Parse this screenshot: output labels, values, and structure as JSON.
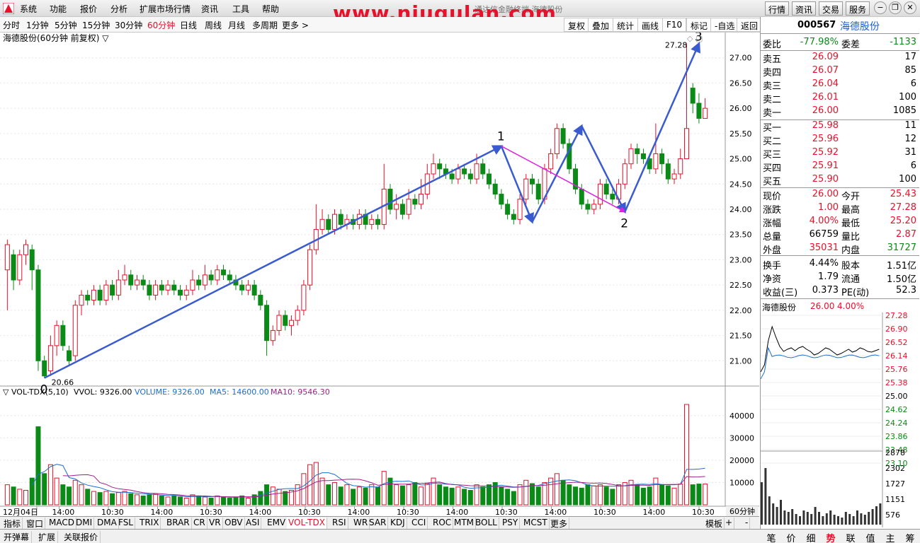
{
  "menu": {
    "items": [
      "系统",
      "功能",
      "报价",
      "分析",
      "扩展市场行情",
      "资讯",
      "工具",
      "帮助"
    ],
    "center_title": "通达信金融终端  海德股份",
    "watermark": "www.niugulan.com",
    "right_buttons": [
      "行情",
      "资讯",
      "交易",
      "服务"
    ]
  },
  "periods": {
    "items": [
      "分时",
      "1分钟",
      "5分钟",
      "15分钟",
      "30分钟",
      "60分钟",
      "日线",
      "周线",
      "月线",
      "多周期",
      "更多 >"
    ],
    "active": "60分钟",
    "tools": [
      "复权",
      "叠加",
      "统计",
      "画线",
      "F10",
      "标记",
      "-自选",
      "返回"
    ]
  },
  "chart": {
    "title": "海德股份(60分钟 前复权) ▽",
    "price_axis": [
      "27.00",
      "26.50",
      "26.00",
      "25.50",
      "25.00",
      "24.50",
      "24.00",
      "23.50",
      "23.00",
      "22.50",
      "22.00",
      "21.50",
      "21.00"
    ],
    "high_label": "27.28",
    "low_label": "20.66",
    "wave_labels": [
      "0",
      "1",
      "2",
      "3"
    ],
    "vol_header": {
      "name": "▽ VOL-TDX(5,10)",
      "vvol": "VVOL: 9326.00",
      "volume": "VOLUME: 9326.00",
      "ma5": "MA5: 14600.00",
      "ma10": "MA10: 9546.30"
    },
    "vol_axis": [
      "40000",
      "30000",
      "20000",
      "10000"
    ],
    "time_axis": [
      "12月04日",
      "14:00",
      "10:30",
      "14:00",
      "10:30",
      "14:00",
      "10:30",
      "14:00",
      "10:30",
      "14:00",
      "10:30",
      "14:00",
      "10:30",
      "14:00",
      "10:30"
    ],
    "period_badge": "60分钟",
    "colors": {
      "up": "#e8102a",
      "down": "#0a8a16",
      "wave": "#3a5bd0",
      "wave2": "#e020e0",
      "ma5": "#1a6fd0",
      "ma10": "#a0208a"
    }
  },
  "chart_data": {
    "type": "candlestick",
    "title": "海德股份(60分钟 前复权)",
    "ylim": [
      20.5,
      27.5
    ],
    "candles": [
      [
        22.8,
        23.3,
        23.4,
        22.0
      ],
      [
        23.1,
        22.6,
        23.2,
        22.4
      ],
      [
        22.6,
        23.1,
        23.2,
        22.5
      ],
      [
        23.1,
        23.3,
        23.4,
        22.9
      ],
      [
        23.2,
        22.8,
        23.3,
        22.4
      ],
      [
        22.8,
        21.0,
        22.9,
        20.8
      ],
      [
        21.0,
        20.7,
        21.1,
        20.66
      ],
      [
        20.8,
        21.3,
        21.5,
        20.7
      ],
      [
        21.3,
        21.7,
        21.8,
        21.1
      ],
      [
        21.7,
        21.3,
        21.8,
        21.2
      ],
      [
        21.2,
        21.0,
        21.3,
        20.9
      ],
      [
        21.1,
        22.1,
        22.2,
        21.0
      ],
      [
        22.1,
        22.3,
        22.4,
        21.9
      ],
      [
        22.3,
        22.2,
        22.4,
        22.1
      ],
      [
        22.2,
        22.4,
        22.5,
        22.1
      ],
      [
        22.4,
        22.2,
        22.5,
        22.1
      ],
      [
        22.2,
        22.5,
        22.6,
        22.1
      ],
      [
        22.5,
        22.3,
        22.6,
        22.2
      ],
      [
        22.3,
        22.6,
        22.8,
        22.2
      ],
      [
        22.6,
        22.7,
        22.9,
        22.5
      ],
      [
        22.7,
        22.5,
        22.8,
        22.4
      ],
      [
        22.5,
        22.6,
        22.7,
        22.4
      ],
      [
        22.6,
        22.5,
        22.7,
        22.4
      ],
      [
        22.5,
        22.3,
        22.6,
        22.2
      ],
      [
        22.3,
        22.5,
        22.6,
        22.2
      ],
      [
        22.5,
        22.4,
        22.6,
        22.3
      ],
      [
        22.4,
        22.5,
        22.6,
        22.3
      ],
      [
        22.5,
        22.4,
        22.6,
        22.3
      ],
      [
        22.4,
        22.3,
        22.5,
        22.2
      ],
      [
        22.3,
        22.4,
        22.5,
        22.2
      ],
      [
        22.4,
        22.6,
        22.8,
        22.3
      ],
      [
        22.6,
        22.5,
        22.7,
        22.4
      ],
      [
        22.5,
        22.7,
        22.9,
        22.4
      ],
      [
        22.7,
        22.6,
        22.8,
        22.5
      ],
      [
        22.6,
        22.8,
        22.9,
        22.5
      ],
      [
        22.8,
        22.7,
        22.9,
        22.6
      ],
      [
        22.7,
        22.6,
        22.8,
        22.5
      ],
      [
        22.6,
        22.5,
        22.7,
        22.4
      ],
      [
        22.5,
        22.4,
        22.6,
        22.3
      ],
      [
        22.4,
        22.5,
        22.6,
        22.3
      ],
      [
        22.5,
        22.3,
        22.6,
        22.2
      ],
      [
        22.3,
        22.1,
        22.4,
        22.0
      ],
      [
        22.1,
        21.4,
        22.2,
        21.1
      ],
      [
        21.4,
        21.6,
        21.7,
        21.3
      ],
      [
        21.6,
        21.9,
        22.0,
        21.5
      ],
      [
        21.9,
        21.7,
        22.0,
        21.6
      ],
      [
        21.7,
        21.8,
        21.9,
        21.5
      ],
      [
        21.8,
        22.0,
        22.1,
        21.7
      ],
      [
        22.0,
        22.5,
        22.6,
        21.9
      ],
      [
        22.5,
        23.2,
        23.3,
        22.4
      ],
      [
        23.2,
        23.6,
        24.1,
        23.1
      ],
      [
        23.6,
        23.8,
        24.0,
        23.5
      ],
      [
        23.8,
        23.6,
        23.9,
        23.5
      ],
      [
        23.6,
        23.9,
        24.0,
        23.5
      ],
      [
        23.9,
        23.7,
        24.0,
        23.6
      ],
      [
        23.7,
        23.8,
        23.9,
        23.6
      ],
      [
        23.8,
        23.7,
        23.9,
        23.6
      ],
      [
        23.7,
        23.9,
        24.0,
        23.6
      ],
      [
        23.9,
        23.7,
        24.0,
        23.6
      ],
      [
        23.7,
        23.8,
        23.9,
        23.6
      ],
      [
        23.8,
        23.7,
        23.9,
        23.6
      ],
      [
        23.7,
        24.4,
        24.9,
        23.6
      ],
      [
        24.4,
        24.0,
        24.5,
        23.9
      ],
      [
        24.0,
        24.1,
        24.3,
        23.8
      ],
      [
        24.1,
        23.9,
        24.2,
        23.8
      ],
      [
        23.9,
        24.2,
        24.4,
        23.8
      ],
      [
        24.2,
        24.1,
        24.3,
        24.0
      ],
      [
        24.1,
        24.3,
        24.6,
        24.0
      ],
      [
        24.3,
        24.7,
        24.9,
        24.2
      ],
      [
        24.7,
        24.9,
        25.1,
        24.6
      ],
      [
        24.9,
        24.8,
        25.0,
        24.6
      ],
      [
        24.8,
        24.7,
        24.9,
        24.6
      ],
      [
        24.7,
        24.6,
        24.8,
        24.5
      ],
      [
        24.6,
        24.8,
        24.9,
        24.5
      ],
      [
        24.8,
        24.7,
        24.9,
        24.6
      ],
      [
        24.7,
        24.6,
        24.8,
        24.5
      ],
      [
        24.6,
        24.9,
        25.1,
        24.5
      ],
      [
        24.9,
        24.7,
        25.0,
        24.6
      ],
      [
        24.7,
        24.5,
        24.8,
        24.4
      ],
      [
        24.5,
        24.3,
        24.6,
        24.2
      ],
      [
        24.3,
        24.1,
        24.4,
        24.0
      ],
      [
        24.1,
        23.9,
        24.2,
        23.8
      ],
      [
        23.9,
        23.8,
        24.0,
        23.7
      ],
      [
        23.8,
        24.2,
        24.3,
        23.7
      ],
      [
        24.2,
        24.6,
        24.7,
        24.1
      ],
      [
        24.6,
        24.5,
        24.7,
        24.3
      ],
      [
        24.5,
        24.2,
        24.6,
        24.1
      ],
      [
        24.2,
        24.8,
        24.9,
        24.1
      ],
      [
        24.8,
        25.1,
        25.2,
        24.7
      ],
      [
        25.1,
        25.6,
        25.7,
        25.0
      ],
      [
        25.6,
        25.3,
        25.7,
        25.2
      ],
      [
        25.3,
        24.8,
        25.4,
        24.7
      ],
      [
        24.8,
        24.4,
        24.9,
        24.3
      ],
      [
        24.4,
        24.1,
        24.5,
        24.0
      ],
      [
        24.1,
        24.0,
        24.2,
        23.9
      ],
      [
        24.0,
        24.1,
        24.2,
        23.9
      ],
      [
        24.1,
        24.5,
        24.6,
        24.0
      ],
      [
        24.5,
        24.3,
        24.6,
        24.2
      ],
      [
        24.3,
        24.2,
        24.4,
        24.1
      ],
      [
        24.2,
        24.5,
        24.6,
        24.1
      ],
      [
        24.5,
        24.9,
        25.0,
        24.4
      ],
      [
        24.9,
        25.2,
        25.3,
        24.8
      ],
      [
        25.2,
        25.1,
        25.3,
        24.9
      ],
      [
        25.1,
        25.0,
        25.2,
        24.9
      ],
      [
        25.0,
        24.8,
        25.1,
        24.7
      ],
      [
        24.8,
        25.1,
        25.7,
        24.7
      ],
      [
        25.1,
        24.9,
        25.2,
        24.7
      ],
      [
        24.9,
        24.6,
        25.0,
        24.5
      ],
      [
        24.6,
        24.7,
        24.8,
        24.5
      ],
      [
        24.7,
        25.0,
        25.2,
        24.6
      ],
      [
        25.0,
        25.6,
        27.28,
        25.2
      ],
      [
        26.4,
        26.1,
        26.5,
        25.9
      ],
      [
        26.1,
        25.8,
        26.3,
        25.7
      ],
      [
        25.8,
        26.0,
        26.2,
        25.8
      ]
    ],
    "volume": [
      9000,
      8000,
      7000,
      6500,
      12000,
      35000,
      14000,
      18000,
      12000,
      9000,
      8000,
      11000,
      9000,
      7000,
      6000,
      5500,
      6000,
      5000,
      5500,
      6000,
      5000,
      4500,
      4000,
      4500,
      5000,
      4000,
      3500,
      4000,
      3500,
      3000,
      4500,
      4000,
      3500,
      3000,
      4000,
      3500,
      3000,
      3500,
      4000,
      3000,
      4500,
      6000,
      9000,
      8000,
      7000,
      6000,
      6500,
      9000,
      14000,
      18000,
      19000,
      12000,
      9000,
      10000,
      8000,
      9000,
      7000,
      8000,
      7500,
      9000,
      8000,
      15000,
      12000,
      9000,
      8500,
      9000,
      10000,
      8000,
      9500,
      12000,
      9000,
      8000,
      7500,
      8000,
      7000,
      6500,
      9000,
      8000,
      9000,
      10000,
      8000,
      7000,
      6000,
      9000,
      11000,
      9500,
      8000,
      10000,
      12000,
      14000,
      11000,
      9000,
      8000,
      7500,
      9000,
      8500,
      9000,
      8000,
      7000,
      9000,
      10000,
      11000,
      9000,
      7500,
      8000,
      12000,
      9000,
      8500,
      7500,
      9326,
      45000,
      9000,
      9326,
      9326
    ],
    "vol_ylim": [
      0,
      45000
    ]
  },
  "quote": {
    "code": "000567",
    "name": "海德股份",
    "weibi_label": "委比",
    "weibi": "-77.98%",
    "weicha_label": "委差",
    "weicha": "-1133",
    "asks": [
      {
        "label": "卖五",
        "price": "26.09",
        "vol": "17"
      },
      {
        "label": "卖四",
        "price": "26.07",
        "vol": "85"
      },
      {
        "label": "卖三",
        "price": "26.04",
        "vol": "6"
      },
      {
        "label": "卖二",
        "price": "26.01",
        "vol": "100"
      },
      {
        "label": "卖一",
        "price": "26.00",
        "vol": "1085"
      }
    ],
    "bids": [
      {
        "label": "买一",
        "price": "25.98",
        "vol": "11"
      },
      {
        "label": "买二",
        "price": "25.96",
        "vol": "12"
      },
      {
        "label": "买三",
        "price": "25.92",
        "vol": "31"
      },
      {
        "label": "买四",
        "price": "25.91",
        "vol": "6"
      },
      {
        "label": "买五",
        "price": "25.90",
        "vol": "100"
      }
    ],
    "stats": [
      [
        {
          "l": "现价",
          "v": "26.00",
          "c": "red"
        },
        {
          "l": "今开",
          "v": "25.43",
          "c": "red"
        }
      ],
      [
        {
          "l": "涨跌",
          "v": "1.00",
          "c": "red"
        },
        {
          "l": "最高",
          "v": "27.28",
          "c": "red"
        }
      ],
      [
        {
          "l": "涨幅",
          "v": "4.00%",
          "c": "red"
        },
        {
          "l": "最低",
          "v": "25.20",
          "c": "red"
        }
      ],
      [
        {
          "l": "总量",
          "v": "66759",
          "c": "black"
        },
        {
          "l": "量比",
          "v": "2.87",
          "c": "red"
        }
      ],
      [
        {
          "l": "外盘",
          "v": "35031",
          "c": "red"
        },
        {
          "l": "内盘",
          "v": "31727",
          "c": "green"
        }
      ],
      [
        {
          "l": "换手",
          "v": "4.44%",
          "c": "black"
        },
        {
          "l": "股本",
          "v": "1.51亿",
          "c": "black"
        }
      ],
      [
        {
          "l": "净资",
          "v": "1.79",
          "c": "black"
        },
        {
          "l": "流通",
          "v": "1.50亿",
          "c": "black"
        }
      ],
      [
        {
          "l": "收益(三)",
          "v": "0.373",
          "c": "black"
        },
        {
          "l": "PE(动)",
          "v": "52.3",
          "c": "black"
        }
      ]
    ],
    "mini": {
      "title": "海德股份",
      "price": "26.00",
      "pct": "4.00%",
      "axis": [
        "27.28",
        "26.90",
        "26.52",
        "26.14",
        "25.76",
        "25.38",
        "25.00",
        "24.62",
        "24.24",
        "23.86",
        "23.48",
        "23.10"
      ],
      "vol_axis": [
        "2878",
        "2302",
        "1727",
        "1151",
        "576"
      ]
    }
  },
  "indicators": [
    "指标",
    "窗口",
    "MACD",
    "DMI",
    "DMA",
    "FSL",
    "TRIX",
    "BRAR",
    "CR",
    "VR",
    "OBV",
    "ASI",
    "EMV",
    "VOL-TDX",
    "RSI",
    "WR",
    "SAR",
    "KDJ",
    "CCI",
    "ROC",
    "MTM",
    "BOLL",
    "PSY",
    "MCST",
    "更多"
  ],
  "active_indicator": "VOL-TDX",
  "indbar_right": [
    "模板",
    "+",
    "-"
  ],
  "status": {
    "left": [
      "开弹幕",
      "扩展",
      "关联报价"
    ],
    "right": [
      "笔",
      "价",
      "细",
      "势",
      "联",
      "值",
      "主",
      "筹"
    ],
    "active_right": "势"
  }
}
